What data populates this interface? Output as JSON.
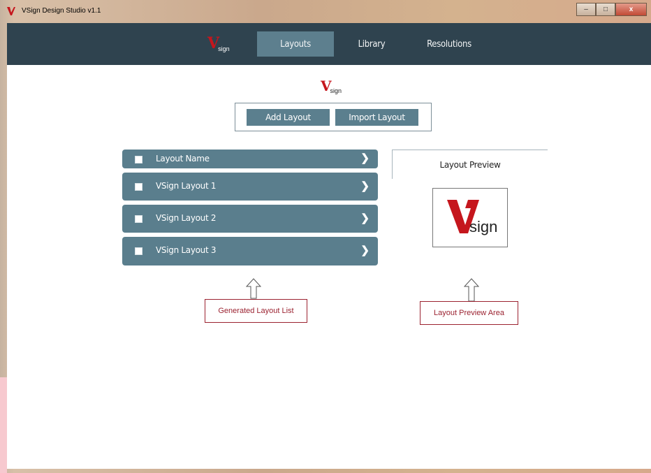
{
  "window": {
    "title": "VSign Design Studio v1.1",
    "minimize": "–",
    "maximize": "□",
    "close": "x"
  },
  "logo": {
    "v": "V",
    "sign": "sign"
  },
  "nav": {
    "tabs": [
      {
        "label": "Layouts"
      },
      {
        "label": "Library"
      },
      {
        "label": "Resolutions"
      }
    ]
  },
  "actions": {
    "add_layout": "Add Layout",
    "import_layout": "Import Layout"
  },
  "layout_list": {
    "header": "Layout Name",
    "items": [
      {
        "label": "VSign Layout 1"
      },
      {
        "label": "VSign Layout 2"
      },
      {
        "label": "VSign Layout 3"
      }
    ]
  },
  "preview": {
    "title": "Layout Preview"
  },
  "annotations": {
    "list_callout": "Generated Layout List",
    "preview_callout": "Layout Preview Area"
  },
  "colors": {
    "navbar": "#2f434f",
    "accent": "#5b7f8e",
    "brand_red": "#c5161d",
    "callout": "#9b2230"
  }
}
